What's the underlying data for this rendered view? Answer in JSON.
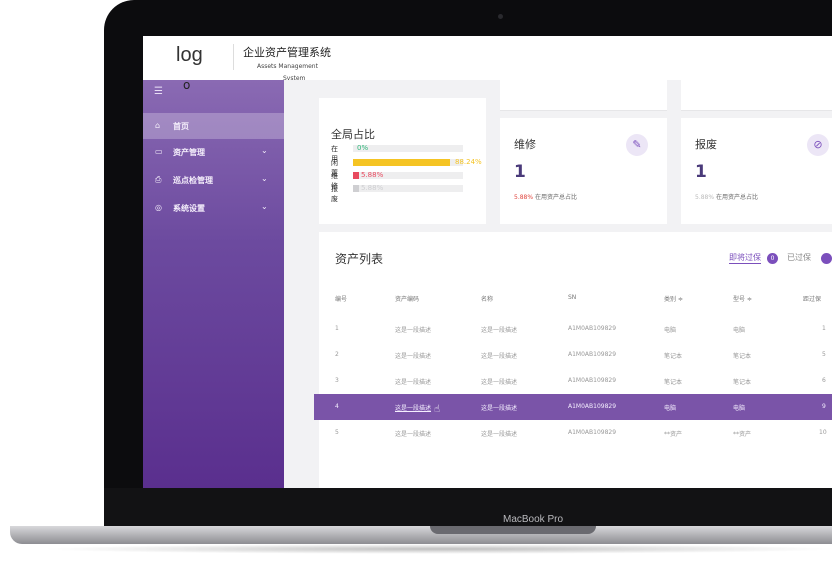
{
  "device": {
    "brand": "MacBook Pro"
  },
  "header": {
    "logo": "log",
    "logo_dot": "o",
    "title_cn": "企业资产管理系统",
    "title_en_line1": "Assets Management",
    "title_en_line2": "System"
  },
  "sidebar": {
    "toggle_icon": "menu-icon",
    "items": [
      {
        "label": "首页",
        "icon": "home-icon",
        "active": true
      },
      {
        "label": "资产管理",
        "icon": "asset-icon",
        "active": false
      },
      {
        "label": "巡点检管理",
        "icon": "inspection-icon",
        "active": false
      },
      {
        "label": "系统设置",
        "icon": "settings-icon",
        "active": false
      }
    ]
  },
  "overview": {
    "title": "全局占比",
    "rows": [
      {
        "name": "在用",
        "pct": "0%",
        "value": 0,
        "color": "#2fb67a"
      },
      {
        "name": "闲置",
        "pct": "88.24%",
        "value": 88.24,
        "color": "#f5c423"
      },
      {
        "name": "维修",
        "pct": "5.88%",
        "value": 5.88,
        "color": "#e84a5f"
      },
      {
        "name": "报废",
        "pct": "5.88%",
        "value": 5.88,
        "color": "#cfcfd2"
      }
    ]
  },
  "kpis": [
    {
      "title": "维修",
      "count": "1",
      "pct": "5.88%",
      "desc": "在用资产总占比",
      "icon": "wrench-icon"
    },
    {
      "title": "报废",
      "count": "1",
      "pct": "5.88%",
      "desc": "在用资产总占比",
      "icon": "scrap-icon"
    }
  ],
  "asset_list": {
    "title": "资产列表",
    "tab_expiring": "即将过保",
    "tab_expiring_count": "0",
    "tab_expired": "已过保",
    "headers": [
      "编号",
      "资产编码",
      "名称",
      "SN",
      "类别 ≑",
      "型号 ≑",
      "距过保"
    ],
    "rows": [
      [
        "1",
        "这是一段描述",
        "这是一段描述",
        "A1M0AB109829",
        "电脑",
        "电脑",
        "1"
      ],
      [
        "2",
        "这是一段描述",
        "这是一段描述",
        "A1M0AB109829",
        "笔记本",
        "笔记本",
        "5"
      ],
      [
        "3",
        "这是一段描述",
        "这是一段描述",
        "A1M0AB109829",
        "笔记本",
        "笔记本",
        "6"
      ],
      [
        "4",
        "这是一段描述",
        "这是一段描述",
        "A1M0AB109829",
        "电脑",
        "电脑",
        "9"
      ],
      [
        "5",
        "这是一段描述",
        "这是一段描述",
        "A1M0AB109829",
        "**资产",
        "**资产",
        "10"
      ]
    ],
    "selected_row": 4
  }
}
